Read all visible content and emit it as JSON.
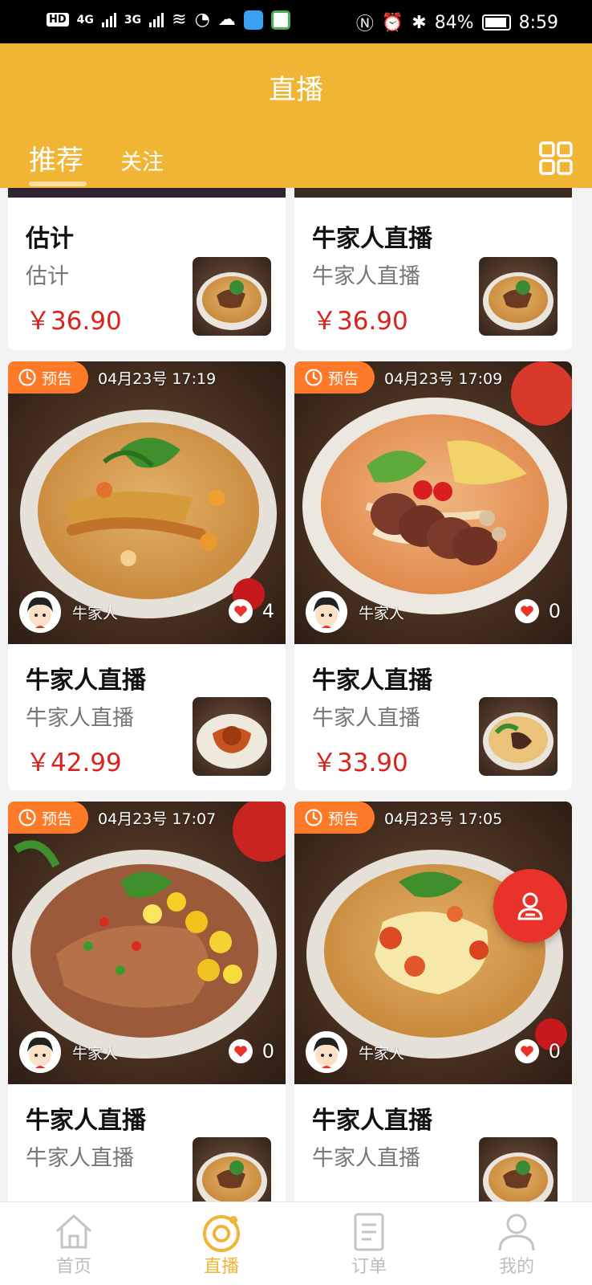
{
  "status_bar": {
    "left_badge": "HD",
    "sig1": "4G",
    "sig2": "3G",
    "battery_pct": "84%",
    "time": "8:59"
  },
  "header": {
    "title": "直播",
    "tabs": [
      {
        "label": "推荐",
        "active": true
      },
      {
        "label": "关注",
        "active": false
      }
    ],
    "accent": "#f0b535"
  },
  "cards": [
    {
      "name": "估计",
      "sub": "估计",
      "price": "￥36.90"
    },
    {
      "name": "牛家人直播",
      "sub": "牛家人直播",
      "price": "￥36.90"
    },
    {
      "badge": "预告",
      "time": "04月23号 17:19",
      "host": "牛家人",
      "likes": "4",
      "name": "牛家人直播",
      "sub": "牛家人直播",
      "price": "￥42.99"
    },
    {
      "badge": "预告",
      "time": "04月23号 17:09",
      "host": "牛家人",
      "likes": "0",
      "name": "牛家人直播",
      "sub": "牛家人直播",
      "price": "￥33.90"
    },
    {
      "badge": "预告",
      "time": "04月23号 17:07",
      "host": "牛家人",
      "likes": "0",
      "name": "牛家人直播",
      "sub": "牛家人直播"
    },
    {
      "badge": "预告",
      "time": "04月23号 17:05",
      "host": "牛家人",
      "likes": "0",
      "name": "牛家人直播",
      "sub": "牛家人直播"
    }
  ],
  "bottom_nav": [
    {
      "label": "首页",
      "icon": "home-icon"
    },
    {
      "label": "直播",
      "icon": "live-icon",
      "active": true
    },
    {
      "label": "订单",
      "icon": "order-icon"
    },
    {
      "label": "我的",
      "icon": "profile-icon"
    }
  ],
  "colors": {
    "price": "#d9231b",
    "badge": "#ff7a28",
    "fab": "#e8322a"
  }
}
